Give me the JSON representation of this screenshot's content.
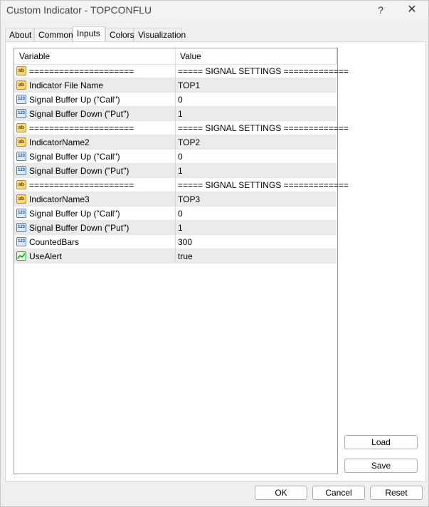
{
  "window": {
    "title": "Custom Indicator - TOPCONFLU",
    "help_glyph": "?",
    "close_glyph": "✕"
  },
  "tabs": [
    {
      "label": "About",
      "active": false
    },
    {
      "label": "Common",
      "active": false
    },
    {
      "label": "Inputs",
      "active": true
    },
    {
      "label": "Colors",
      "active": false
    },
    {
      "label": "Visualization",
      "active": false
    }
  ],
  "grid": {
    "headers": {
      "variable": "Variable",
      "value": "Value"
    },
    "rows": [
      {
        "icon": "ab-string-icon",
        "icon_text": "ab",
        "name": "=====================",
        "value": "===== SIGNAL SETTINGS ============="
      },
      {
        "icon": "ab-string-icon",
        "icon_text": "ab",
        "name": "Indicator File Name",
        "value": "TOP1"
      },
      {
        "icon": "123-number-icon",
        "icon_text": "123",
        "name": "Signal Buffer Up (\"Call\")",
        "value": "0"
      },
      {
        "icon": "123-number-icon",
        "icon_text": "123",
        "name": "Signal Buffer Down (\"Put\")",
        "value": "1"
      },
      {
        "icon": "ab-string-icon",
        "icon_text": "ab",
        "name": "=====================",
        "value": "===== SIGNAL SETTINGS ============="
      },
      {
        "icon": "ab-string-icon",
        "icon_text": "ab",
        "name": "IndicatorName2",
        "value": "TOP2"
      },
      {
        "icon": "123-number-icon",
        "icon_text": "123",
        "name": "Signal Buffer Up (\"Call\")",
        "value": "0"
      },
      {
        "icon": "123-number-icon",
        "icon_text": "123",
        "name": "Signal Buffer Down (\"Put\")",
        "value": "1"
      },
      {
        "icon": "ab-string-icon",
        "icon_text": "ab",
        "name": "=====================",
        "value": "===== SIGNAL SETTINGS ============="
      },
      {
        "icon": "ab-string-icon",
        "icon_text": "ab",
        "name": "IndicatorName3",
        "value": "TOP3"
      },
      {
        "icon": "123-number-icon",
        "icon_text": "123",
        "name": "Signal Buffer Up (\"Call\")",
        "value": "0"
      },
      {
        "icon": "123-number-icon",
        "icon_text": "123",
        "name": "Signal Buffer Down (\"Put\")",
        "value": "1"
      },
      {
        "icon": "123-number-icon",
        "icon_text": "123",
        "name": "CountedBars",
        "value": "300"
      },
      {
        "icon": "bool-chart-icon",
        "icon_text": "",
        "name": "UseAlert",
        "value": "true"
      }
    ]
  },
  "side_buttons": {
    "load": "Load",
    "save": "Save"
  },
  "bottom_buttons": {
    "ok": "OK",
    "cancel": "Cancel",
    "reset": "Reset"
  },
  "colors": {
    "alt_row": "#ebebeb",
    "string_icon": "#f6d97a",
    "number_icon": "#dbe9fb",
    "bool_icon": "#e2f5e2"
  }
}
